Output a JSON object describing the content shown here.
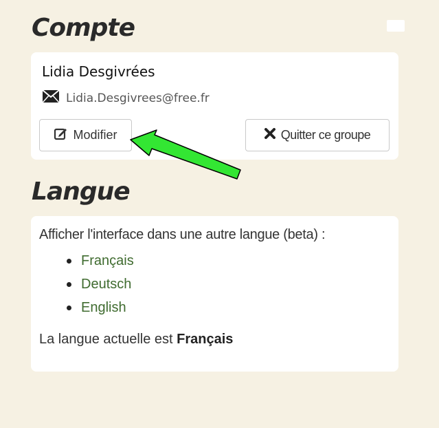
{
  "account": {
    "title": "Compte",
    "user_name": "Lidia Desgivrées",
    "email": "Lidia.Desgivrees@free.fr",
    "edit_label": "Modifier",
    "leave_label": "Quitter ce groupe"
  },
  "language": {
    "title": "Langue",
    "intro": "Afficher l'interface dans une autre langue (beta) :",
    "options": [
      "Français",
      "Deutsch",
      "English"
    ],
    "current_prefix": "La langue actuelle est ",
    "current_value": "Français"
  },
  "colors": {
    "background": "#f6f1e3",
    "link": "#3f6b2f",
    "annotation_arrow": "#33e633"
  },
  "icons": {
    "email": "envelope-icon",
    "edit": "edit-icon",
    "leave": "close-icon"
  }
}
